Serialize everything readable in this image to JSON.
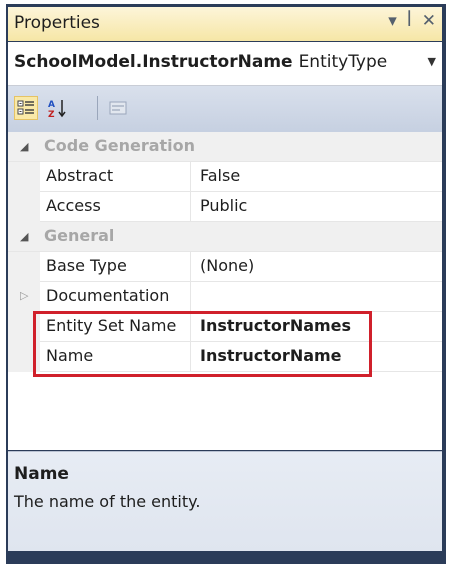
{
  "window": {
    "title": "Properties",
    "controls": {
      "dropdown": "▾",
      "pin": "ꟾ",
      "close": "✕"
    }
  },
  "object_selector": {
    "name": "SchoolModel.InstructorName",
    "type": "EntityType"
  },
  "toolbar": {
    "buttons": [
      {
        "icon": "categorized-icon",
        "active": true
      },
      {
        "icon": "alphabetical-icon",
        "active": false
      },
      {
        "icon": "property-pages-icon",
        "active": false
      }
    ]
  },
  "grid": {
    "rows": [
      {
        "kind": "category",
        "name": "Code Generation",
        "expanded": true
      },
      {
        "kind": "property",
        "name": "Abstract",
        "value": "False",
        "bold": false
      },
      {
        "kind": "property",
        "name": "Access",
        "value": "Public",
        "bold": false
      },
      {
        "kind": "category",
        "name": "General",
        "expanded": true
      },
      {
        "kind": "property",
        "name": "Base Type",
        "value": "(None)",
        "bold": false
      },
      {
        "kind": "property",
        "name": "Documentation",
        "value": "",
        "bold": false,
        "expandable": true
      },
      {
        "kind": "property",
        "name": "Entity Set Name",
        "value": "InstructorNames",
        "bold": true
      },
      {
        "kind": "property",
        "name": "Name",
        "value": "InstructorName",
        "bold": true
      }
    ]
  },
  "description": {
    "title": "Name",
    "text": "The name of the entity."
  },
  "colors": {
    "frame": "#2b3c59",
    "highlight": "#d0202b",
    "titlebar": "#f6e6a6"
  }
}
